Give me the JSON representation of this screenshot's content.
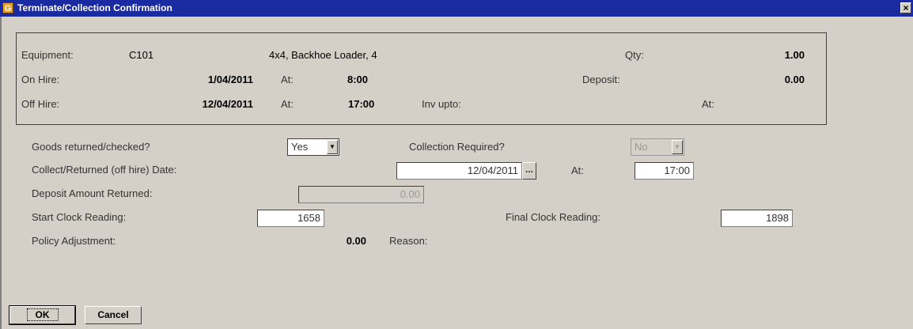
{
  "window": {
    "title": "Terminate/Collection Confirmation",
    "app_icon": "G",
    "close": "×"
  },
  "summary": {
    "equipment_label": "Equipment:",
    "equipment_code": "C101",
    "equipment_desc": "4x4, Backhoe Loader, 4",
    "qty_label": "Qty:",
    "qty_value": "1.00",
    "on_hire_label": "On Hire:",
    "on_hire_date": "1/04/2011",
    "on_hire_at_label": "At:",
    "on_hire_time": "8:00",
    "deposit_label": "Deposit:",
    "deposit_value": "0.00",
    "off_hire_label": "Off Hire:",
    "off_hire_date": "12/04/2011",
    "off_hire_at_label": "At:",
    "off_hire_time": "17:00",
    "inv_upto_label": "Inv upto:",
    "inv_at_label": "At:"
  },
  "form": {
    "goods_returned_label": "Goods returned/checked?",
    "goods_returned_value": "Yes",
    "collection_required_label": "Collection Required?",
    "collection_required_value": "No",
    "collect_date_label": "Collect/Returned (off hire) Date:",
    "collect_date_value": "12/04/2011",
    "date_picker": "...",
    "collect_at_label": "At:",
    "collect_time_value": "17:00",
    "deposit_returned_label": "Deposit Amount Returned:",
    "deposit_returned_value": "0.00",
    "start_clock_label": "Start Clock Reading:",
    "start_clock_value": "1658",
    "final_clock_label": "Final Clock Reading:",
    "final_clock_value": "1898",
    "policy_adjustment_label": "Policy Adjustment:",
    "policy_adjustment_value": "0.00",
    "reason_label": "Reason:"
  },
  "buttons": {
    "ok": "OK",
    "cancel": "Cancel"
  }
}
